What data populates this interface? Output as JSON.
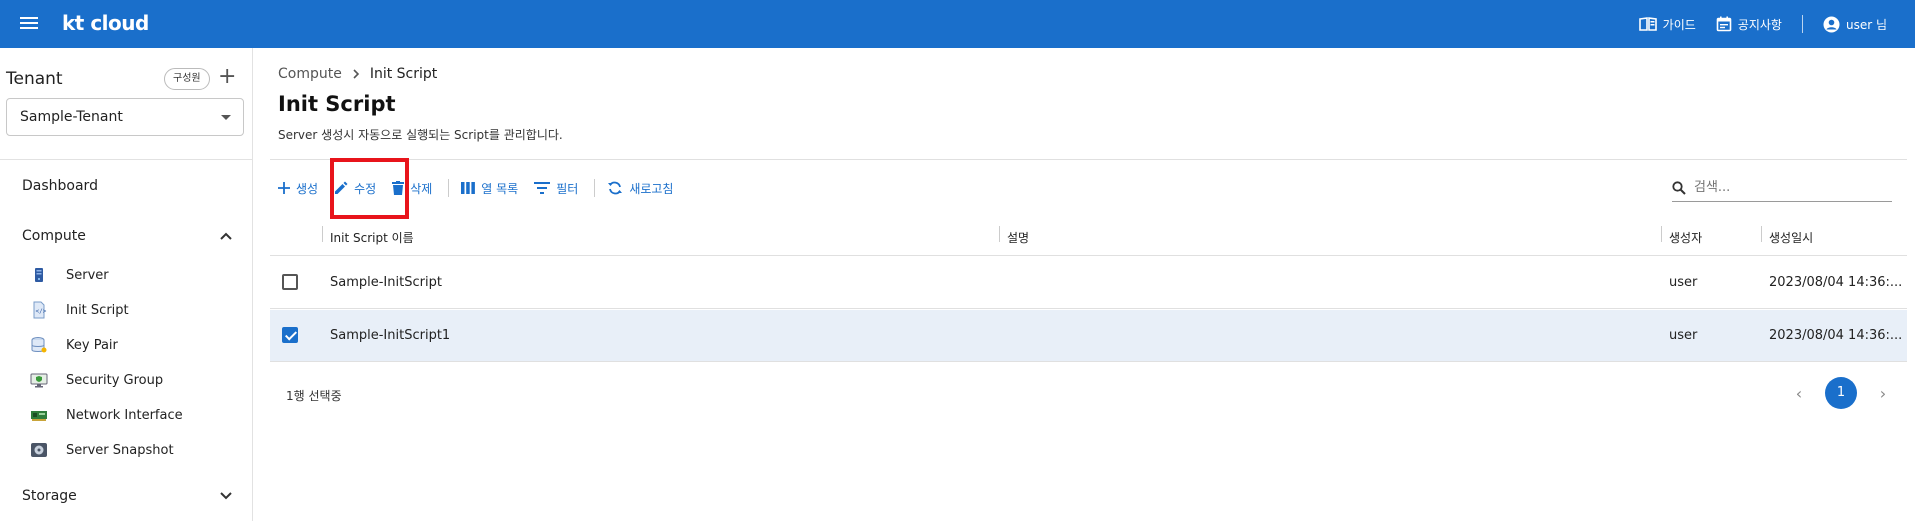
{
  "topbar": {
    "logo": "kt cloud",
    "guide_label": "가이드",
    "notice_label": "공지사항",
    "user_label": "user 님"
  },
  "sidebar": {
    "tenant_title": "Tenant",
    "member_button": "구성원",
    "add_symbol": "+",
    "tenant_selected": "Sample-Tenant",
    "dashboard": "Dashboard",
    "compute_section": "Compute",
    "compute_items": [
      {
        "label": "Server",
        "icon": "server-icon"
      },
      {
        "label": "Init Script",
        "icon": "script-file-icon"
      },
      {
        "label": "Key Pair",
        "icon": "database-key-icon"
      },
      {
        "label": "Security Group",
        "icon": "monitor-shield-icon"
      },
      {
        "label": "Network Interface",
        "icon": "network-card-icon"
      },
      {
        "label": "Server Snapshot",
        "icon": "snapshot-disk-icon"
      }
    ],
    "storage_section": "Storage"
  },
  "main": {
    "breadcrumb": [
      "Compute",
      "Init Script"
    ],
    "title": "Init Script",
    "description": "Server 생성시 자동으로 실행되는 Script를 관리합니다.",
    "toolbar": {
      "create": "생성",
      "edit": "수정",
      "delete": "삭제",
      "columns": "열 목록",
      "filter": "필터",
      "refresh": "새로고침"
    },
    "search_placeholder": "검색...",
    "table": {
      "headers": [
        "Init Script 이름",
        "설명",
        "생성자",
        "생성일시"
      ],
      "rows": [
        {
          "name": "Sample-InitScript",
          "desc": "",
          "creator": "user",
          "created": "2023/08/04 14:36:...",
          "checked": false
        },
        {
          "name": "Sample-InitScript1",
          "desc": "",
          "creator": "user",
          "created": "2023/08/04 14:36:...",
          "checked": true
        }
      ]
    },
    "selection_status": "1행 선택중",
    "pagination": {
      "current": "1"
    }
  },
  "colors": {
    "brand_blue": "#1a6fcb",
    "highlight_red": "#e8141b",
    "selected_row": "#e8eff8"
  }
}
